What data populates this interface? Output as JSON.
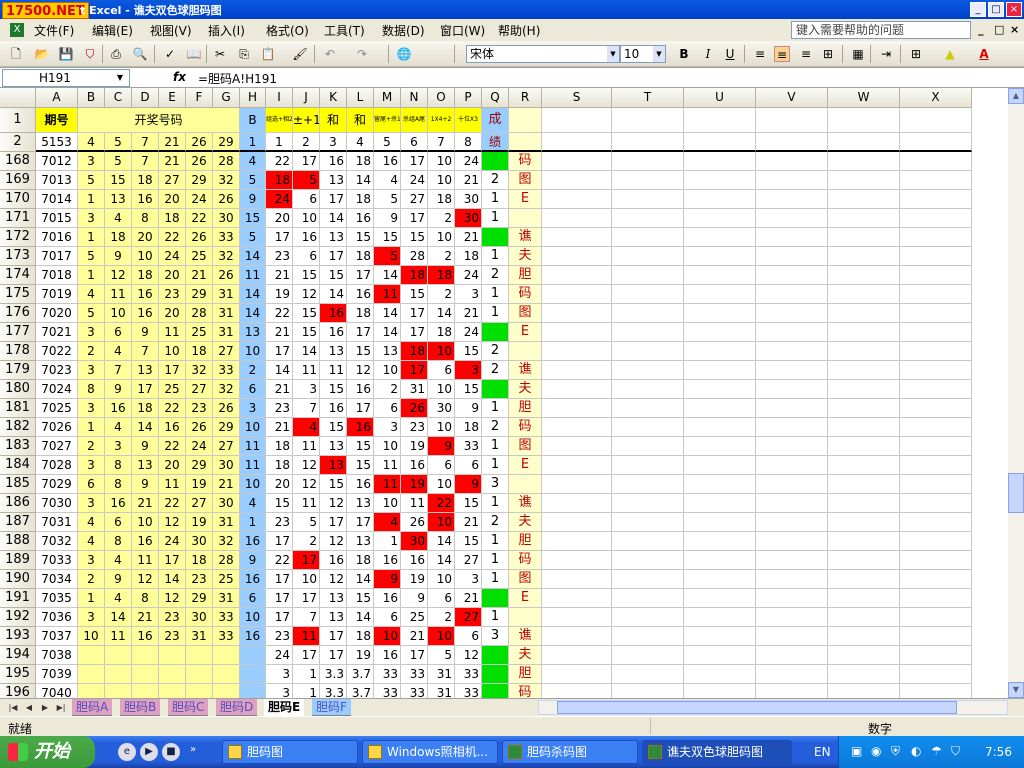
{
  "window": {
    "logo": "17500.NET",
    "title": "t Excel - 谯夫双色球胆码图",
    "min": "_",
    "max": "□",
    "close": "×"
  },
  "menubar": {
    "items": [
      "文件(F)",
      "编辑(E)",
      "视图(V)",
      "插入(I)",
      "格式(O)",
      "工具(T)",
      "数据(D)",
      "窗口(W)",
      "帮助(H)"
    ],
    "help_placeholder": "键入需要帮助的问题",
    "mdi": [
      "_",
      "□",
      "×"
    ]
  },
  "toolbar": {
    "font_name": "宋体",
    "font_size": "10",
    "bold": "B",
    "italic": "I",
    "underline": "U",
    "font_color": "A"
  },
  "formula_bar": {
    "cell_ref": "H191",
    "fx": "fx",
    "formula": "=胆码A!H191"
  },
  "columns": [
    "A",
    "B",
    "C",
    "D",
    "E",
    "F",
    "G",
    "H",
    "I",
    "J",
    "K",
    "L",
    "M",
    "N",
    "O",
    "P",
    "Q",
    "R",
    "S",
    "T",
    "U",
    "V",
    "W",
    "X"
  ],
  "header": {
    "row1": {
      "num": "1",
      "period": "期号",
      "draw": "开奖号码",
      "b": "B",
      "i": "组选+相2",
      "j": "±+1",
      "k": "和",
      "l": "和",
      "m": "留尾+杀1",
      "n": "杀组A尾",
      "o": "1X4+2",
      "p": "十位X3",
      "q": "成"
    },
    "row2": {
      "num": "2",
      "a": "5153",
      "b": "4",
      "c": "5",
      "d": "7",
      "e": "21",
      "f": "26",
      "g": "29",
      "h": "1",
      "i": "1",
      "j": "2",
      "k": "3",
      "l": "4",
      "m": "5",
      "n": "6",
      "o": "7",
      "p": "8",
      "q": "绩"
    }
  },
  "rows": [
    {
      "n": "168",
      "a": "7012",
      "draw": [
        "3",
        "5",
        "7",
        "21",
        "26",
        "28"
      ],
      "h": "4",
      "v": [
        "22",
        "17",
        "16",
        "18",
        "16",
        "17",
        "10",
        "24"
      ],
      "red": [],
      "q": "",
      "qg": true,
      "r": "码"
    },
    {
      "n": "169",
      "a": "7013",
      "draw": [
        "5",
        "15",
        "18",
        "27",
        "29",
        "32"
      ],
      "h": "5",
      "v": [
        "18",
        "5",
        "13",
        "14",
        "4",
        "24",
        "10",
        "21"
      ],
      "red": [
        0,
        1
      ],
      "q": "2",
      "qg": false,
      "r": "图"
    },
    {
      "n": "170",
      "a": "7014",
      "draw": [
        "1",
        "13",
        "16",
        "20",
        "24",
        "26"
      ],
      "h": "9",
      "v": [
        "24",
        "6",
        "17",
        "18",
        "5",
        "27",
        "18",
        "30"
      ],
      "red": [
        0
      ],
      "q": "1",
      "qg": false,
      "r": "E"
    },
    {
      "n": "171",
      "a": "7015",
      "draw": [
        "3",
        "4",
        "8",
        "18",
        "22",
        "30"
      ],
      "h": "15",
      "v": [
        "20",
        "10",
        "14",
        "16",
        "9",
        "17",
        "2",
        "30"
      ],
      "red": [
        7
      ],
      "q": "1",
      "qg": false,
      "r": ""
    },
    {
      "n": "172",
      "a": "7016",
      "draw": [
        "1",
        "18",
        "20",
        "22",
        "26",
        "33"
      ],
      "h": "5",
      "v": [
        "17",
        "16",
        "13",
        "15",
        "15",
        "15",
        "10",
        "21"
      ],
      "red": [],
      "q": "",
      "qg": true,
      "r": "谯"
    },
    {
      "n": "173",
      "a": "7017",
      "draw": [
        "5",
        "9",
        "10",
        "24",
        "25",
        "32"
      ],
      "h": "14",
      "v": [
        "23",
        "6",
        "17",
        "18",
        "5",
        "28",
        "2",
        "18"
      ],
      "red": [
        4
      ],
      "q": "1",
      "qg": false,
      "r": "夫"
    },
    {
      "n": "174",
      "a": "7018",
      "draw": [
        "1",
        "12",
        "18",
        "20",
        "21",
        "26"
      ],
      "h": "11",
      "v": [
        "21",
        "15",
        "15",
        "17",
        "14",
        "18",
        "18",
        "24"
      ],
      "red": [
        5,
        6
      ],
      "q": "2",
      "qg": false,
      "r": "胆"
    },
    {
      "n": "175",
      "a": "7019",
      "draw": [
        "4",
        "11",
        "16",
        "23",
        "29",
        "31"
      ],
      "h": "14",
      "v": [
        "19",
        "12",
        "14",
        "16",
        "11",
        "15",
        "2",
        "3"
      ],
      "red": [
        4
      ],
      "q": "1",
      "qg": false,
      "r": "码"
    },
    {
      "n": "176",
      "a": "7020",
      "draw": [
        "5",
        "10",
        "16",
        "20",
        "28",
        "31"
      ],
      "h": "14",
      "v": [
        "22",
        "15",
        "16",
        "18",
        "14",
        "17",
        "14",
        "21"
      ],
      "red": [
        2
      ],
      "q": "1",
      "qg": false,
      "r": "图"
    },
    {
      "n": "177",
      "a": "7021",
      "draw": [
        "3",
        "6",
        "9",
        "11",
        "25",
        "31"
      ],
      "h": "13",
      "v": [
        "21",
        "15",
        "16",
        "17",
        "14",
        "17",
        "18",
        "24"
      ],
      "red": [],
      "q": "",
      "qg": true,
      "r": "E"
    },
    {
      "n": "178",
      "a": "7022",
      "draw": [
        "2",
        "4",
        "7",
        "10",
        "18",
        "27"
      ],
      "h": "10",
      "v": [
        "17",
        "14",
        "13",
        "15",
        "13",
        "18",
        "10",
        "15"
      ],
      "red": [
        5,
        6
      ],
      "q": "2",
      "qg": false,
      "r": ""
    },
    {
      "n": "179",
      "a": "7023",
      "draw": [
        "3",
        "7",
        "13",
        "17",
        "32",
        "33"
      ],
      "h": "2",
      "v": [
        "14",
        "11",
        "11",
        "12",
        "10",
        "17",
        "6",
        "3"
      ],
      "red": [
        5,
        7
      ],
      "q": "2",
      "qg": false,
      "r": "谯"
    },
    {
      "n": "180",
      "a": "7024",
      "draw": [
        "8",
        "9",
        "17",
        "25",
        "27",
        "32"
      ],
      "h": "6",
      "v": [
        "21",
        "3",
        "15",
        "16",
        "2",
        "31",
        "10",
        "15"
      ],
      "red": [],
      "q": "",
      "qg": true,
      "r": "夫"
    },
    {
      "n": "181",
      "a": "7025",
      "draw": [
        "3",
        "16",
        "18",
        "22",
        "23",
        "26"
      ],
      "h": "3",
      "v": [
        "23",
        "7",
        "16",
        "17",
        "6",
        "26",
        "30",
        "9"
      ],
      "red": [
        5
      ],
      "q": "1",
      "qg": false,
      "r": "胆"
    },
    {
      "n": "182",
      "a": "7026",
      "draw": [
        "1",
        "4",
        "14",
        "16",
        "26",
        "29"
      ],
      "h": "10",
      "v": [
        "21",
        "4",
        "15",
        "16",
        "3",
        "23",
        "10",
        "18"
      ],
      "red": [
        1,
        3
      ],
      "q": "2",
      "qg": false,
      "r": "码"
    },
    {
      "n": "183",
      "a": "7027",
      "draw": [
        "2",
        "3",
        "9",
        "22",
        "24",
        "27"
      ],
      "h": "11",
      "v": [
        "18",
        "11",
        "13",
        "15",
        "10",
        "19",
        "9",
        "33"
      ],
      "red": [
        6
      ],
      "q": "1",
      "qg": false,
      "r": "图"
    },
    {
      "n": "184",
      "a": "7028",
      "draw": [
        "3",
        "8",
        "13",
        "20",
        "29",
        "30"
      ],
      "h": "11",
      "v": [
        "18",
        "12",
        "13",
        "15",
        "11",
        "16",
        "6",
        "6"
      ],
      "red": [
        2
      ],
      "q": "1",
      "qg": false,
      "r": "E"
    },
    {
      "n": "185",
      "a": "7029",
      "draw": [
        "6",
        "8",
        "9",
        "11",
        "19",
        "21"
      ],
      "h": "10",
      "v": [
        "20",
        "12",
        "15",
        "16",
        "11",
        "19",
        "10",
        "9"
      ],
      "red": [
        4,
        5,
        7
      ],
      "q": "3",
      "qg": false,
      "r": ""
    },
    {
      "n": "186",
      "a": "7030",
      "draw": [
        "3",
        "16",
        "21",
        "22",
        "27",
        "30"
      ],
      "h": "4",
      "v": [
        "15",
        "11",
        "12",
        "13",
        "10",
        "11",
        "22",
        "15"
      ],
      "red": [
        6
      ],
      "q": "1",
      "qg": false,
      "r": "谯"
    },
    {
      "n": "187",
      "a": "7031",
      "draw": [
        "4",
        "6",
        "10",
        "12",
        "19",
        "31"
      ],
      "h": "1",
      "v": [
        "23",
        "5",
        "17",
        "17",
        "4",
        "26",
        "10",
        "21"
      ],
      "red": [
        4,
        6
      ],
      "q": "2",
      "qg": false,
      "r": "夫"
    },
    {
      "n": "188",
      "a": "7032",
      "draw": [
        "4",
        "8",
        "16",
        "24",
        "30",
        "32"
      ],
      "h": "16",
      "v": [
        "17",
        "2",
        "12",
        "13",
        "1",
        "30",
        "14",
        "15"
      ],
      "red": [
        5
      ],
      "q": "1",
      "qg": false,
      "r": "胆"
    },
    {
      "n": "189",
      "a": "7033",
      "draw": [
        "3",
        "4",
        "11",
        "17",
        "18",
        "28"
      ],
      "h": "9",
      "v": [
        "22",
        "17",
        "16",
        "18",
        "16",
        "16",
        "14",
        "27"
      ],
      "red": [
        1
      ],
      "q": "1",
      "qg": false,
      "r": "码"
    },
    {
      "n": "190",
      "a": "7034",
      "draw": [
        "2",
        "9",
        "12",
        "14",
        "23",
        "25"
      ],
      "h": "16",
      "v": [
        "17",
        "10",
        "12",
        "14",
        "9",
        "19",
        "10",
        "3"
      ],
      "red": [
        4
      ],
      "q": "1",
      "qg": false,
      "r": "图"
    },
    {
      "n": "191",
      "a": "7035",
      "draw": [
        "1",
        "4",
        "8",
        "12",
        "29",
        "31"
      ],
      "h": "6",
      "v": [
        "17",
        "17",
        "13",
        "15",
        "16",
        "9",
        "6",
        "21"
      ],
      "red": [],
      "q": "",
      "qg": true,
      "r": "E"
    },
    {
      "n": "192",
      "a": "7036",
      "draw": [
        "3",
        "14",
        "21",
        "23",
        "30",
        "33"
      ],
      "h": "10",
      "v": [
        "17",
        "7",
        "13",
        "14",
        "6",
        "25",
        "2",
        "27"
      ],
      "red": [
        7
      ],
      "q": "1",
      "qg": false,
      "r": ""
    },
    {
      "n": "193",
      "a": "7037",
      "draw": [
        "10",
        "11",
        "16",
        "23",
        "31",
        "33"
      ],
      "h": "16",
      "v": [
        "23",
        "11",
        "17",
        "18",
        "10",
        "21",
        "10",
        "6"
      ],
      "red": [
        1,
        4,
        6
      ],
      "q": "3",
      "qg": false,
      "r": "谯"
    },
    {
      "n": "194",
      "a": "7038",
      "draw": [
        "",
        "",
        "",
        "",
        "",
        ""
      ],
      "h": "",
      "v": [
        "24",
        "17",
        "17",
        "19",
        "16",
        "17",
        "5",
        "12"
      ],
      "red": [],
      "q": "",
      "qg": true,
      "r": "夫"
    },
    {
      "n": "195",
      "a": "7039",
      "draw": [
        "",
        "",
        "",
        "",
        "",
        ""
      ],
      "h": "",
      "v": [
        "3",
        "1",
        "3.3",
        "3.7",
        "33",
        "33",
        "31",
        "33"
      ],
      "red": [],
      "q": "",
      "qg": true,
      "r": "胆"
    },
    {
      "n": "196",
      "a": "7040",
      "draw": [
        "",
        "",
        "",
        "",
        "",
        ""
      ],
      "h": "",
      "v": [
        "3",
        "1",
        "3.3",
        "3.7",
        "33",
        "33",
        "31",
        "33"
      ],
      "red": [],
      "q": "",
      "qg": true,
      "r": "码"
    }
  ],
  "sheet_tabs": [
    "胆码A",
    "胆码B",
    "胆码C",
    "胆码D",
    "胆码E",
    "胆码F"
  ],
  "active_tab": "胆码E",
  "status": {
    "ready": "就绪",
    "mode": "数字"
  },
  "taskbar": {
    "start": "开始",
    "tasks": [
      "胆码图",
      "Windows照相机...",
      "胆码杀码图",
      "谯夫双色球胆码图"
    ],
    "lang": "EN",
    "clock": "7:56"
  },
  "colors": {
    "red_hit": "#ff0000",
    "green": "#00e000",
    "yellow": "#ffff99",
    "blue": "#99ccff",
    "header_yellow": "#ffff00",
    "r_text": "#c00000"
  }
}
